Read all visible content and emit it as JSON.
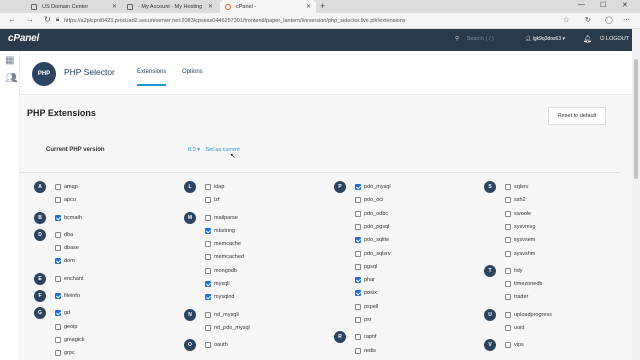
{
  "browser": {
    "tabs": [
      {
        "label": "US Domain Center"
      },
      {
        "label": "- My Account - My Hosting"
      },
      {
        "label": "cPanel -"
      }
    ],
    "url": "https://a2plcpnl0423.prod.iad2.secureserver.net:2083/cpsess0446257301/frontend/paper_lantern/lveversion/php_selector.live.pl#/extensions"
  },
  "cpanel": {
    "logo": "cPanel",
    "search_placeholder": "Search ( / )",
    "user": "lgk9q3dos63",
    "logout": "LOGOUT"
  },
  "page": {
    "title": "PHP Selector",
    "icon_text": "PHP",
    "tabs": [
      {
        "label": "Extensions"
      },
      {
        "label": "Options"
      }
    ]
  },
  "content": {
    "heading": "PHP Extensions",
    "reset_label": "Reset to default",
    "version_label": "Current PHP version",
    "version_value": "8.0",
    "set_current": "Set as current"
  },
  "colors": {
    "accent": "#179bd7",
    "topbar": "#293a4a",
    "checked": "#1f72d4"
  },
  "columns": [
    {
      "groups": [
        {
          "letter": "A",
          "items": [
            {
              "n": "amqp",
              "c": false
            },
            {
              "n": "apcu",
              "c": false
            }
          ]
        },
        {
          "letter": "B",
          "items": [
            {
              "n": "bcmath",
              "c": true
            }
          ]
        },
        {
          "letter": "D",
          "items": [
            {
              "n": "dba",
              "c": false
            },
            {
              "n": "dbase",
              "c": false
            },
            {
              "n": "dom",
              "c": true
            }
          ]
        },
        {
          "letter": "E",
          "items": [
            {
              "n": "enchant",
              "c": false
            }
          ]
        },
        {
          "letter": "F",
          "items": [
            {
              "n": "fileinfo",
              "c": true
            }
          ]
        },
        {
          "letter": "G",
          "items": [
            {
              "n": "gd",
              "c": true
            },
            {
              "n": "geoip",
              "c": false
            },
            {
              "n": "gmagick",
              "c": false
            },
            {
              "n": "grpc",
              "c": false
            }
          ]
        }
      ]
    },
    {
      "groups": [
        {
          "letter": "L",
          "items": [
            {
              "n": "ldap",
              "c": false
            },
            {
              "n": "lzf",
              "c": false
            }
          ]
        },
        {
          "letter": "M",
          "items": [
            {
              "n": "mailparse",
              "c": false
            },
            {
              "n": "mbstring",
              "c": true
            },
            {
              "n": "memcache",
              "c": false
            },
            {
              "n": "memcached",
              "c": false
            },
            {
              "n": "mongodb",
              "c": false
            },
            {
              "n": "mysqli",
              "c": true
            },
            {
              "n": "mysqlnd",
              "c": true
            }
          ]
        },
        {
          "letter": "N",
          "items": [
            {
              "n": "nd_mysqli",
              "c": false
            },
            {
              "n": "nd_pdo_mysql",
              "c": false
            }
          ]
        },
        {
          "letter": "O",
          "items": [
            {
              "n": "oauth",
              "c": false
            }
          ]
        }
      ]
    },
    {
      "groups": [
        {
          "letter": "P",
          "items": [
            {
              "n": "pdo_mysql",
              "c": true
            },
            {
              "n": "pdo_oci",
              "c": false
            },
            {
              "n": "pdo_odbc",
              "c": false
            },
            {
              "n": "pdo_pgsql",
              "c": false
            },
            {
              "n": "pdo_sqlite",
              "c": true
            },
            {
              "n": "pdo_sqlsrv",
              "c": false
            },
            {
              "n": "pgsql",
              "c": false
            },
            {
              "n": "phar",
              "c": true
            },
            {
              "n": "posix",
              "c": true
            },
            {
              "n": "pspell",
              "c": false
            },
            {
              "n": "psr",
              "c": false
            }
          ]
        },
        {
          "letter": "R",
          "items": [
            {
              "n": "raphf",
              "c": false
            },
            {
              "n": "redis",
              "c": false
            }
          ]
        }
      ]
    },
    {
      "groups": [
        {
          "letter": "S",
          "items": [
            {
              "n": "sqlsrv",
              "c": false
            },
            {
              "n": "ssh2",
              "c": false
            },
            {
              "n": "swoole",
              "c": false
            },
            {
              "n": "sysvmsg",
              "c": false
            },
            {
              "n": "sysvsem",
              "c": false
            },
            {
              "n": "sysvshm",
              "c": false
            }
          ]
        },
        {
          "letter": "T",
          "items": [
            {
              "n": "tidy",
              "c": false
            },
            {
              "n": "timezonedb",
              "c": false
            },
            {
              "n": "trader",
              "c": false
            }
          ]
        },
        {
          "letter": "U",
          "items": [
            {
              "n": "uploadprogress",
              "c": false
            },
            {
              "n": "uuid",
              "c": false
            }
          ]
        },
        {
          "letter": "V",
          "items": [
            {
              "n": "vips",
              "c": false
            }
          ]
        }
      ]
    }
  ]
}
